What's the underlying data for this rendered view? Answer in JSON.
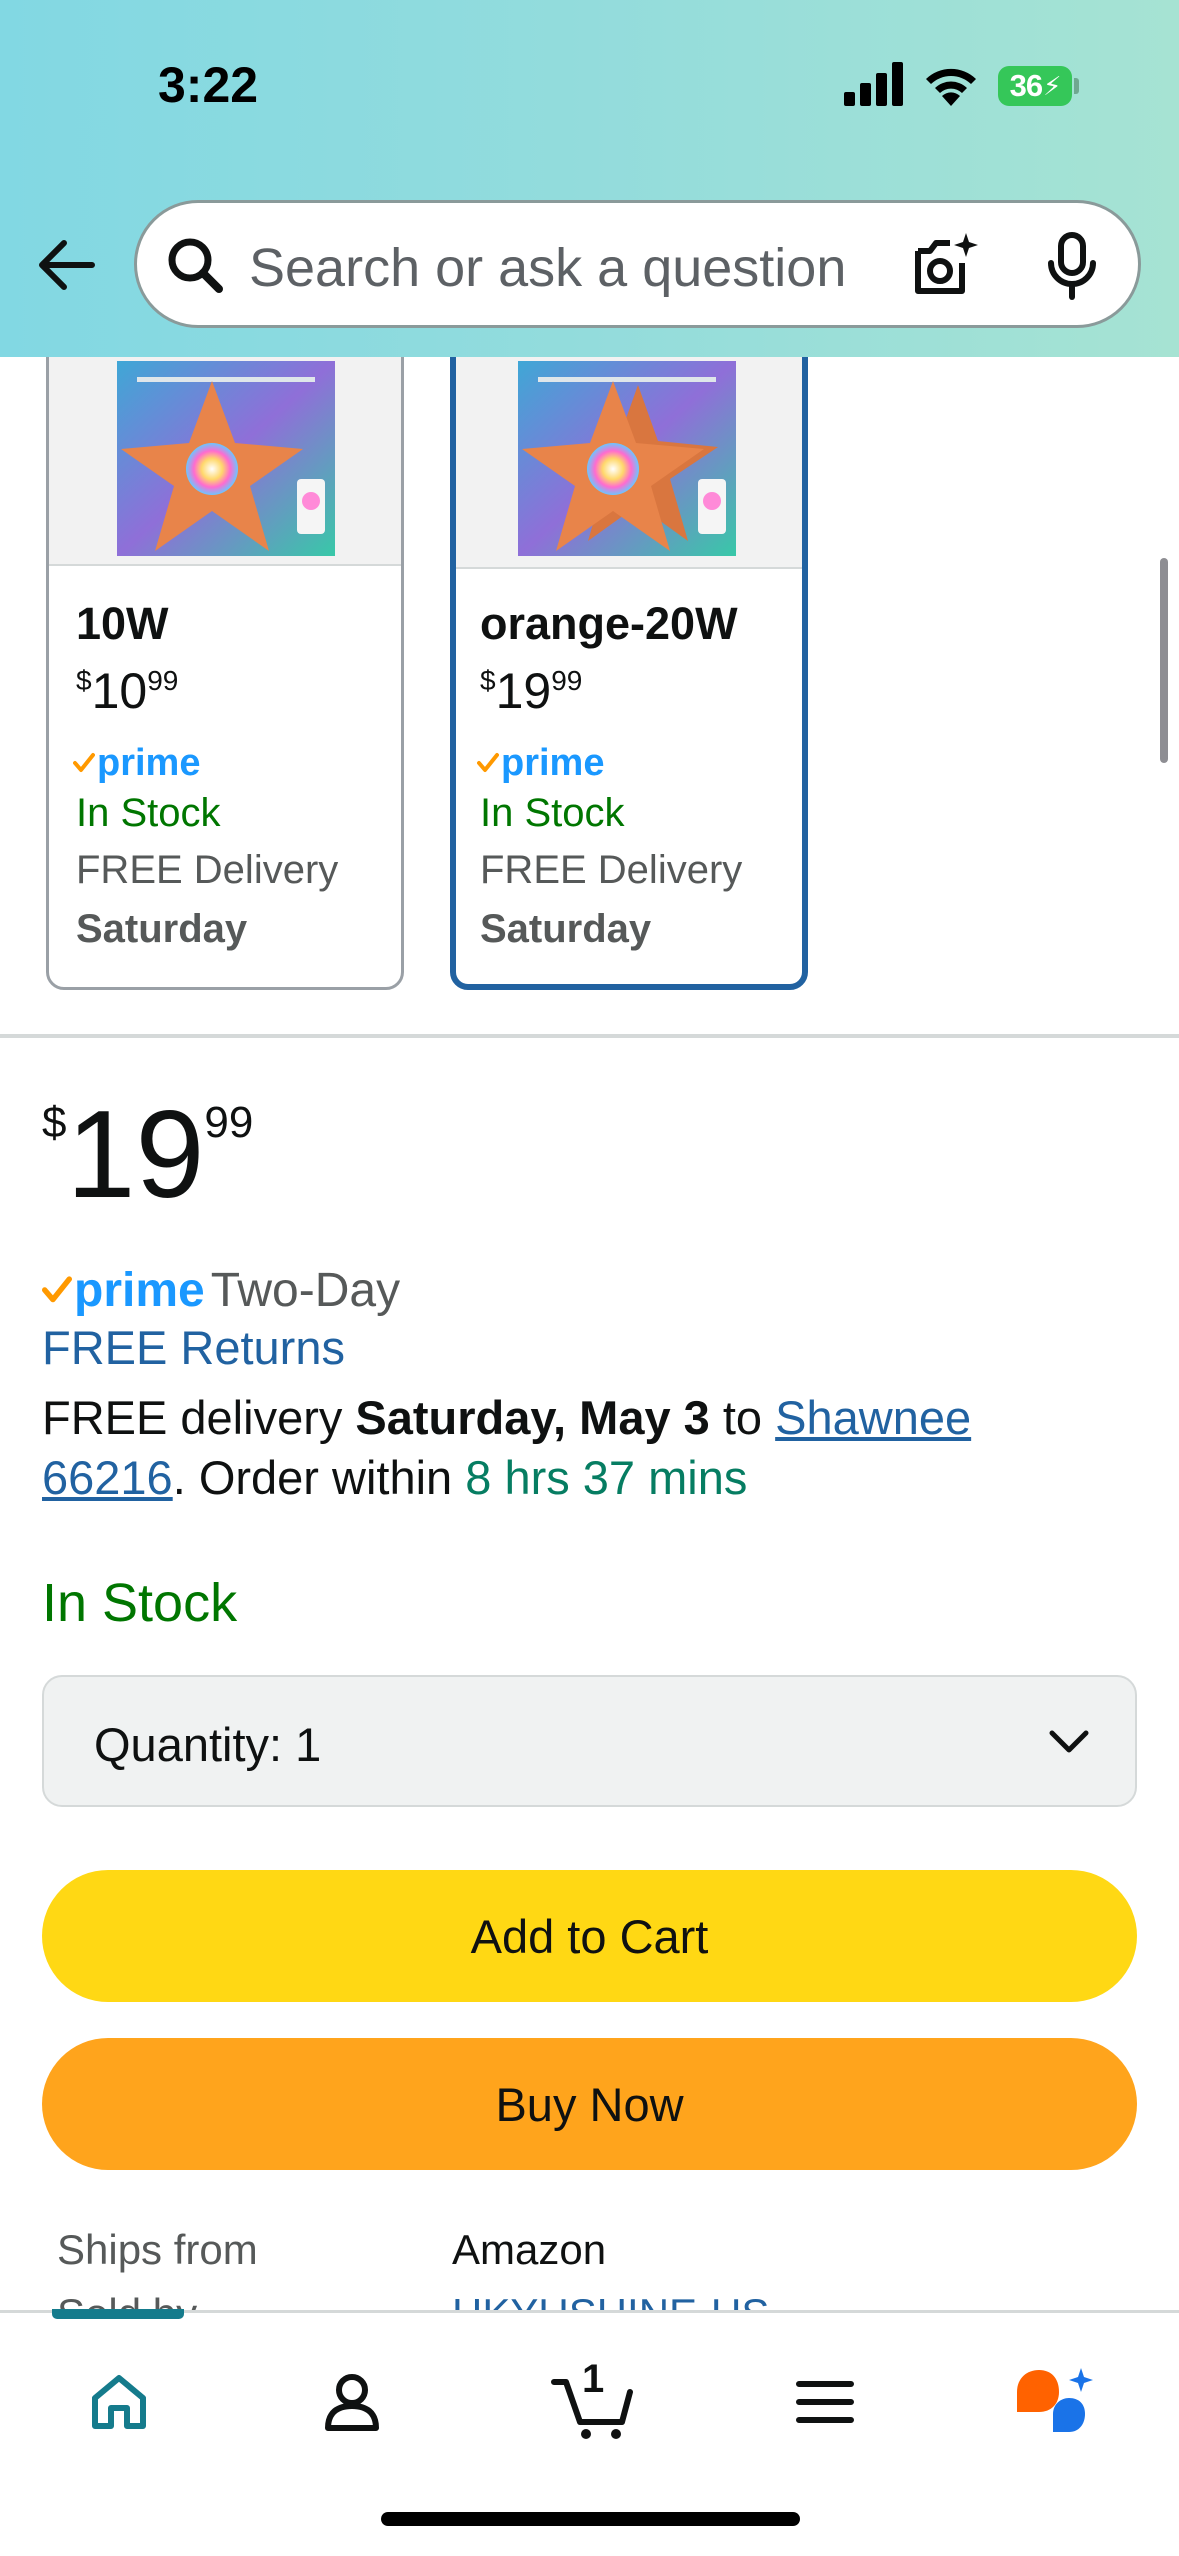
{
  "status_bar": {
    "time": "3:22",
    "battery": "36"
  },
  "header": {
    "search_placeholder": "Search or ask a question"
  },
  "variants": [
    {
      "name": "10W",
      "price_symbol": "$",
      "price_whole": "10",
      "price_cents": "99",
      "prime_label": "prime",
      "stock": "In Stock",
      "delivery": "FREE Delivery",
      "delivery_day": "Saturday",
      "selected": false
    },
    {
      "name": "orange-20W",
      "price_symbol": "$",
      "price_whole": "19",
      "price_cents": "99",
      "prime_label": "prime",
      "stock": "In Stock",
      "delivery": "FREE Delivery",
      "delivery_day": "Saturday",
      "selected": true
    }
  ],
  "buybox": {
    "price_symbol": "$",
    "price_whole": "19",
    "price_cents": "99",
    "prime_label": "prime",
    "prime_suffix": "Two-Day",
    "free_returns": "FREE Returns",
    "delivery_prefix": "FREE delivery ",
    "delivery_date": "Saturday, May 3",
    "delivery_to": " to ",
    "location_line1": "Shawnee",
    "location_line2": "66216",
    "order_within_prefix": ". Order within ",
    "order_within_time": "8 hrs 37 mins",
    "stock": "In Stock",
    "quantity_label": "Quantity:",
    "quantity_value": "1",
    "add_to_cart": "Add to Cart",
    "buy_now": "Buy Now",
    "ships_from_label": "Ships from",
    "ships_from_value": "Amazon",
    "sold_by_label_partial": "Sold by",
    "sold_by_value_partial": "HKYUSHINE-US"
  },
  "bottom_nav": {
    "cart_count": "1",
    "items": [
      "home-icon",
      "account-icon",
      "cart-icon",
      "menu-icon",
      "rufus-ai-icon"
    ]
  },
  "colors": {
    "header_gradient_start": "#82d8e3",
    "header_gradient_end": "#a6e3d3",
    "link_blue": "#2162a1",
    "stock_green": "#007600",
    "timer_green": "#067d62",
    "add_to_cart_yellow": "#ffd814",
    "buy_now_orange": "#ffa41c",
    "prime_blue": "#1a98ff",
    "prime_check_orange": "#ff9900",
    "selected_border": "#2162a1"
  }
}
